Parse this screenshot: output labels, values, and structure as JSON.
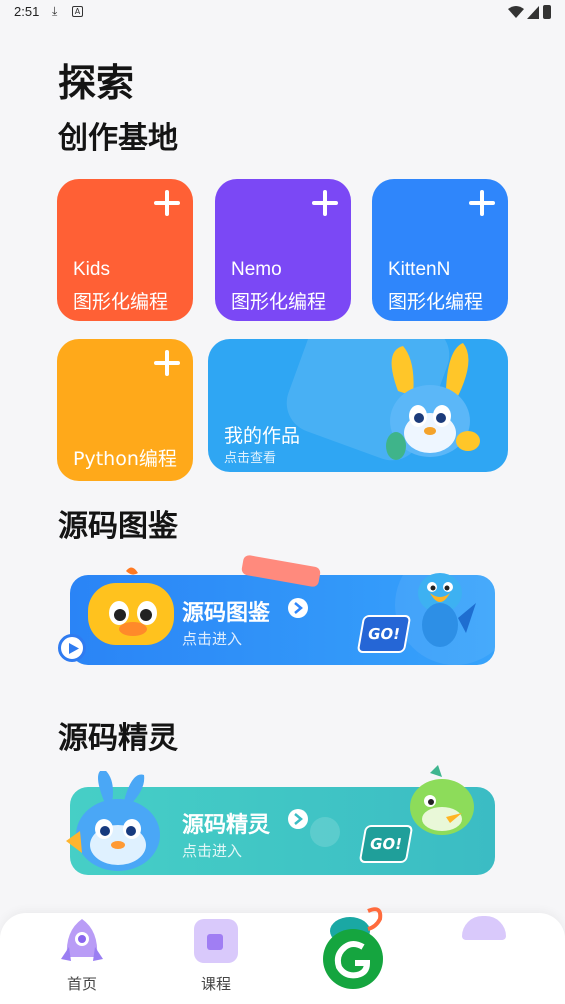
{
  "status_bar": {
    "time": "2:51"
  },
  "page": {
    "title": "探索"
  },
  "create": {
    "heading": "创作基地",
    "tiles": [
      {
        "line1": "Kids",
        "line2": "图形化编程",
        "color": "#ff6035"
      },
      {
        "line1": "Nemo",
        "line2": "图形化编程",
        "color": "#7b48f5"
      },
      {
        "line1": "KittenN",
        "line2": "图形化编程",
        "color": "#2f86fb"
      },
      {
        "line1": "",
        "line2": "Python编程",
        "color": "#ffa91a"
      }
    ],
    "works": {
      "title": "我的作品",
      "subtitle": "点击查看"
    }
  },
  "codex": {
    "heading": "源码图鉴",
    "banner": {
      "title": "源码图鉴",
      "subtitle": "点击进入",
      "go": "GO!",
      "color": "#2f8cf8"
    }
  },
  "spirit": {
    "heading": "源码精灵",
    "banner": {
      "title": "源码精灵",
      "subtitle": "点击进入",
      "go": "GO!",
      "color": "#3cc4c1"
    }
  },
  "tabbar": {
    "items": [
      {
        "label": "首页",
        "icon": "rocket-icon"
      },
      {
        "label": "课程",
        "icon": "course-icon"
      },
      {
        "label": "",
        "icon": "app-logo-icon"
      },
      {
        "label": "",
        "icon": "profile-icon"
      }
    ]
  }
}
